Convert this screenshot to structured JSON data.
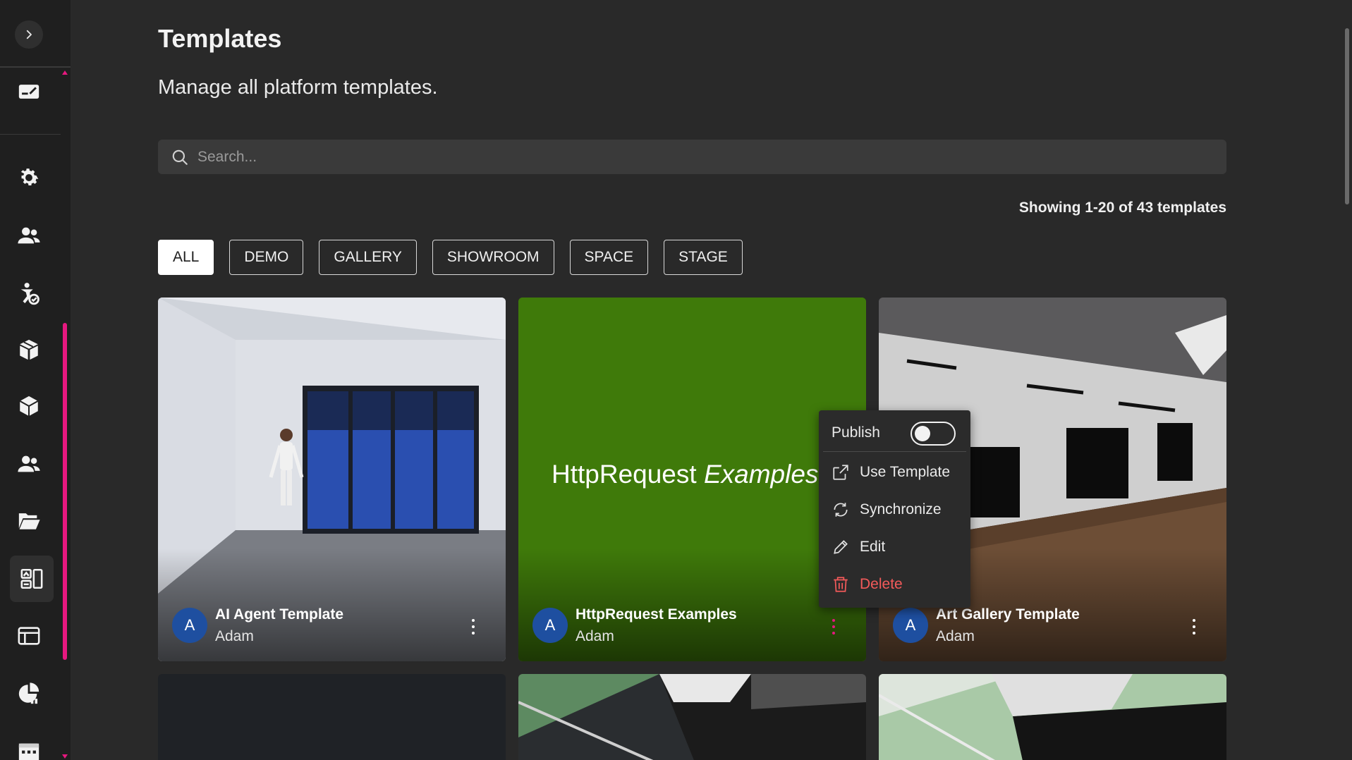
{
  "page": {
    "title": "Templates",
    "subtitle": "Manage all platform templates."
  },
  "search": {
    "placeholder": "Search..."
  },
  "results_count": "Showing 1-20 of 43 templates",
  "filters": [
    {
      "label": "ALL",
      "active": true
    },
    {
      "label": "DEMO",
      "active": false
    },
    {
      "label": "GALLERY",
      "active": false
    },
    {
      "label": "SHOWROOM",
      "active": false
    },
    {
      "label": "SPACE",
      "active": false
    },
    {
      "label": "STAGE",
      "active": false
    }
  ],
  "sidebar": {
    "items": [
      {
        "icon": "dashboard-card-icon"
      },
      {
        "icon": "gear-icon"
      },
      {
        "icon": "users-icon"
      },
      {
        "icon": "accessibility-icon"
      },
      {
        "icon": "boxes-icon"
      },
      {
        "icon": "cube-icon"
      },
      {
        "icon": "group-icon"
      },
      {
        "icon": "folder-open-icon"
      },
      {
        "icon": "templates-icon",
        "active": true
      },
      {
        "icon": "layout-icon"
      },
      {
        "icon": "analytics-icon"
      },
      {
        "icon": "calendar-icon"
      }
    ]
  },
  "cards": [
    {
      "name": "AI Agent Template",
      "author": "Adam",
      "avatar": "A"
    },
    {
      "name": "HttpRequest Examples",
      "author": "Adam",
      "avatar": "A",
      "thumb_text_regular": "HttpRequest ",
      "thumb_text_italic": "Examples"
    },
    {
      "name": "Art Gallery Template",
      "author": "Adam",
      "avatar": "A"
    }
  ],
  "context_menu": {
    "publish_label": "Publish",
    "publish_on": false,
    "items": [
      {
        "label": "Use Template",
        "icon": "external-link-icon"
      },
      {
        "label": "Synchronize",
        "icon": "sync-icon"
      },
      {
        "label": "Edit",
        "icon": "pencil-icon"
      },
      {
        "label": "Delete",
        "icon": "trash-icon",
        "danger": true
      }
    ]
  },
  "colors": {
    "accent": "#e6187f",
    "avatar": "#1e4fa0",
    "danger": "#f25a5a",
    "background": "#292929",
    "sidebar": "#1f1f1f"
  }
}
